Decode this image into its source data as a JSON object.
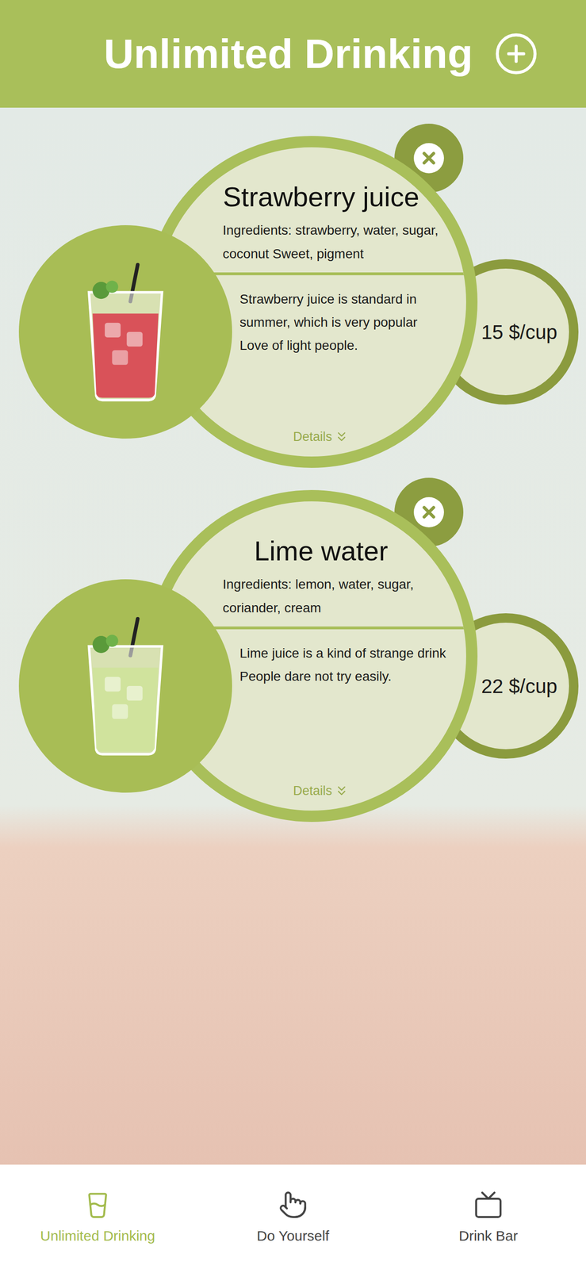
{
  "header": {
    "title": "Unlimited Drinking"
  },
  "drinks": [
    {
      "name": "Strawberry juice",
      "ingredients": "Ingredients: strawberry, water, sugar, coconut Sweet, pigment",
      "description": "Strawberry juice is standard in summer, which is very popular Love of light people.",
      "details": "Details",
      "price": "15 $/cup",
      "color": "#d9434f"
    },
    {
      "name": "Lime water",
      "ingredients": "Ingredients: lemon, water, sugar, coriander, cream",
      "description": "Lime juice is a kind of strange drink People dare not try easily.",
      "details": "Details",
      "price": "22 $/cup",
      "color": "#cfe39a"
    }
  ],
  "tab_bar": [
    {
      "label": "Unlimited Drinking",
      "selected": true
    },
    {
      "label": "Do Yourself",
      "selected": false
    },
    {
      "label": "Drink Bar",
      "selected": false
    }
  ]
}
